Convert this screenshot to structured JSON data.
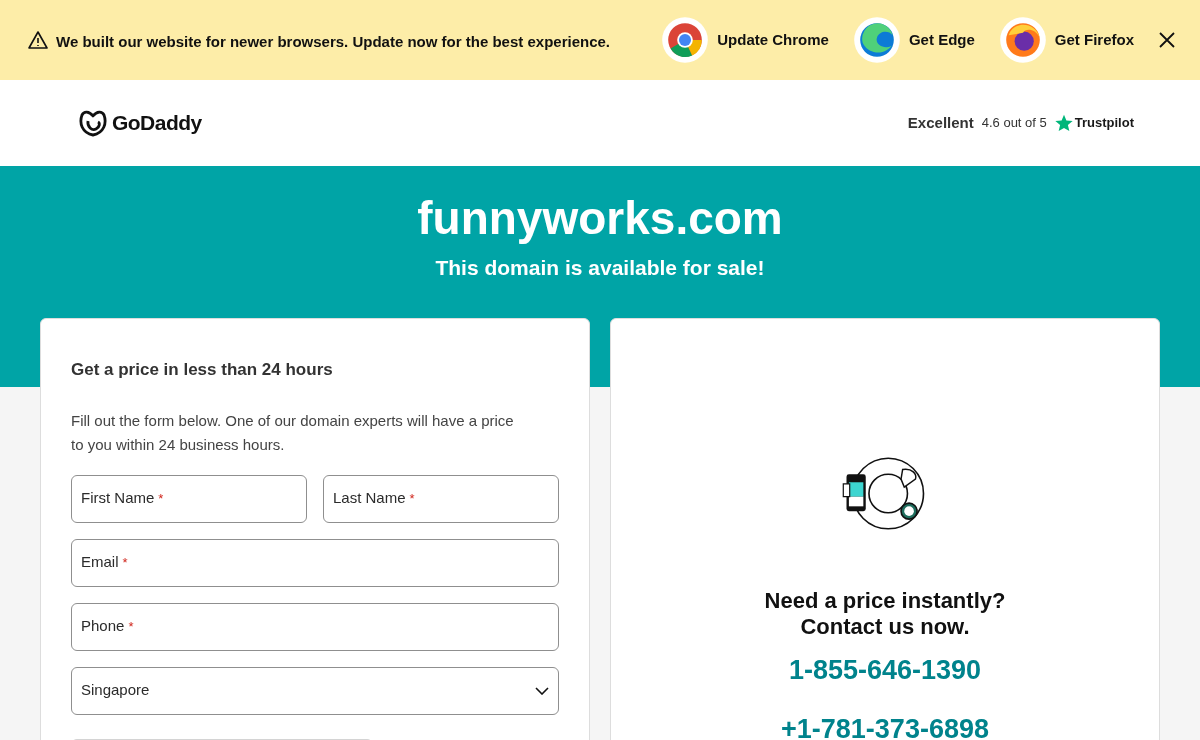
{
  "banner": {
    "message": "We built our website for newer browsers. Update now for the best experience.",
    "browsers": [
      {
        "kind": "chrome",
        "label": "Update Chrome"
      },
      {
        "kind": "edge",
        "label": "Get Edge"
      },
      {
        "kind": "firefox",
        "label": "Get Firefox"
      }
    ]
  },
  "header": {
    "logo": "GoDaddy",
    "rating": {
      "word": "Excellent",
      "score": "4.6 out of 5",
      "brand": "Trustpilot"
    }
  },
  "hero": {
    "domain": "funnyworks.com",
    "subtitle": "This domain is available for sale!"
  },
  "form": {
    "title": "Get a price in less than 24 hours",
    "description": "Fill out the form below. One of our domain experts will have a price to you within 24 business hours.",
    "rows": [
      [
        {
          "label": "First Name",
          "marker": "*"
        },
        {
          "label": "Last Name",
          "marker": "*"
        }
      ],
      [
        {
          "label": "Email",
          "marker": "*"
        }
      ],
      [
        {
          "label": "Phone",
          "marker": "*"
        }
      ]
    ],
    "country": "Singapore"
  },
  "contact": {
    "heading": "Need a price instantly?",
    "subheading": "Contact us now.",
    "phones": [
      "1-855-646-1390",
      "+1-781-373-6898"
    ]
  }
}
